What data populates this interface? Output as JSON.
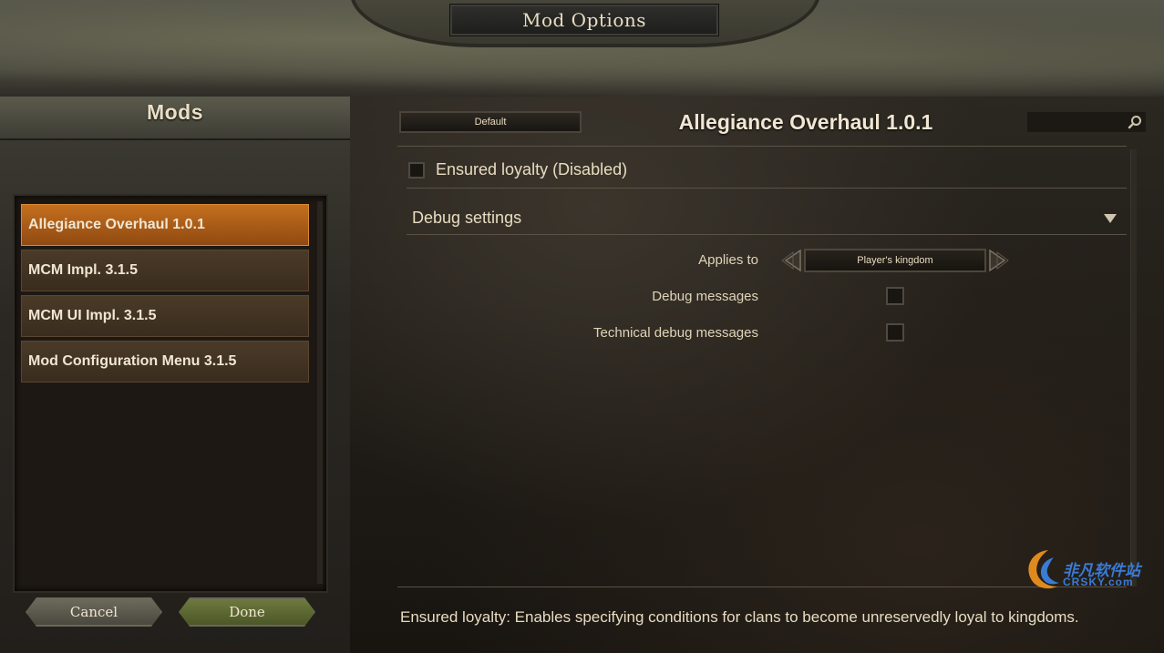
{
  "window": {
    "title": "Mod Options"
  },
  "sidebar": {
    "title": "Mods",
    "items": [
      {
        "label": "Allegiance Overhaul 1.0.1",
        "selected": true
      },
      {
        "label": "MCM Impl. 3.1.5",
        "selected": false
      },
      {
        "label": "MCM UI Impl. 3.1.5",
        "selected": false
      },
      {
        "label": "Mod Configuration Menu 3.1.5",
        "selected": false
      }
    ],
    "cancel_label": "Cancel",
    "done_label": "Done"
  },
  "main": {
    "default_label": "Default",
    "mod_title": "Allegiance Overhaul 1.0.1",
    "search": {
      "placeholder": "",
      "icon": "search-icon"
    },
    "ensured_loyalty": {
      "label": "Ensured loyalty (Disabled)",
      "checked": false
    },
    "debug_group": {
      "label": "Debug settings",
      "icon": "triangle-down-icon"
    },
    "options": {
      "applies_to": {
        "label": "Applies to",
        "value": "Player's kingdom"
      },
      "debug_messages": {
        "label": "Debug messages",
        "checked": false
      },
      "technical_debug_messages": {
        "label": "Technical debug messages",
        "checked": false
      }
    },
    "hint": "Ensured loyalty: Enables specifying conditions for clans to become unreservedly loyal to kingdoms."
  },
  "watermark": {
    "text": "非凡软件站",
    "sub": "CRSKY.com"
  },
  "colors": {
    "accent": "#c56f1e",
    "done": "#6d7a3e",
    "watermark": "#3a7bd5"
  }
}
